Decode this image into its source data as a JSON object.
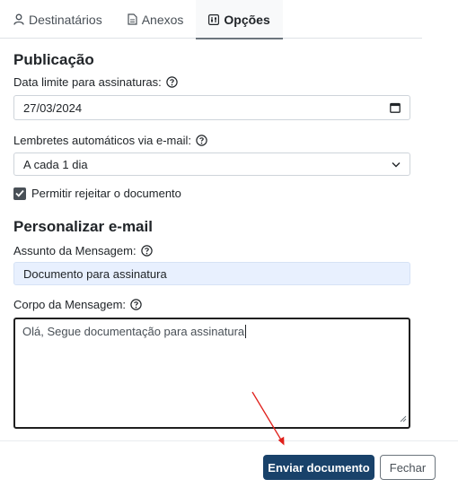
{
  "tabs": [
    {
      "label": "Destinatários",
      "icon": "person-icon"
    },
    {
      "label": "Anexos",
      "icon": "document-icon"
    },
    {
      "label": "Opções",
      "icon": "sliders-icon"
    }
  ],
  "publication": {
    "title": "Publicação",
    "deadline_label": "Data limite para assinaturas:",
    "deadline_value": "27/03/2024",
    "reminders_label": "Lembretes automáticos via e-mail:",
    "reminders_value": "A cada 1 dia",
    "allow_reject_label": "Permitir rejeitar o documento",
    "allow_reject_checked": true
  },
  "email": {
    "title": "Personalizar e-mail",
    "subject_label": "Assunto da Mensagem:",
    "subject_value": "Documento para assinatura",
    "body_label": "Corpo da Mensagem:",
    "body_value": "Olá, Segue documentação para assinatura"
  },
  "actions": {
    "send_label": "Enviar documento",
    "close_label": "Fechar"
  },
  "colors": {
    "primary": "#19426a",
    "annotation_arrow": "#e0201b",
    "filled_field": "#e8f0fe"
  }
}
